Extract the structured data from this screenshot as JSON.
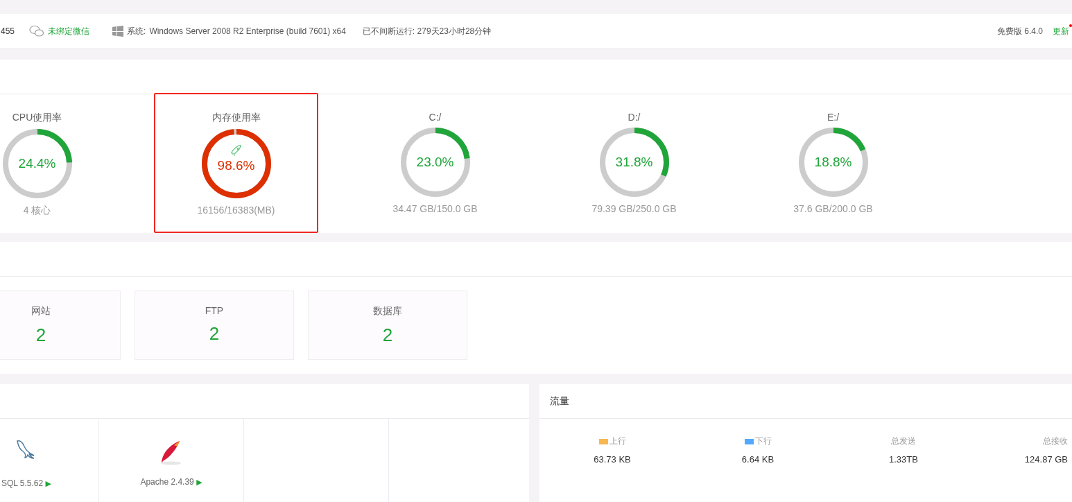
{
  "header": {
    "id_fragment": "455",
    "wechat": "未绑定微信",
    "system_label": "系统:",
    "system": "Windows Server 2008 R2 Enterprise (build 7601) x64",
    "uptime": "已不间断运行: 279天23小时28分钟",
    "version": "免费版 6.4.0",
    "update": "更新",
    "update_dot": true
  },
  "gauges": [
    {
      "title": "CPU使用率",
      "value": "24.4%",
      "level": 0.244,
      "detail": "4 核心",
      "color": "#20a53a",
      "highlighted": false,
      "rocket": false
    },
    {
      "title": "内存使用率",
      "value": "98.6%",
      "level": 0.986,
      "detail": "16156/16383(MB)",
      "color": "#dd2f00",
      "highlighted": true,
      "rocket": true
    },
    {
      "title": "C:/",
      "value": "23.0%",
      "level": 0.23,
      "detail": "34.47 GB/150.0 GB",
      "color": "#20a53a",
      "highlighted": false,
      "rocket": false
    },
    {
      "title": "D:/",
      "value": "31.8%",
      "level": 0.318,
      "detail": "79.39 GB/250.0 GB",
      "color": "#20a53a",
      "highlighted": false,
      "rocket": false
    },
    {
      "title": "E:/",
      "value": "18.8%",
      "level": 0.188,
      "detail": "37.6 GB/200.0 GB",
      "color": "#20a53a",
      "highlighted": false,
      "rocket": false
    }
  ],
  "stats": [
    {
      "label": "网站",
      "count": "2"
    },
    {
      "label": "FTP",
      "count": "2"
    },
    {
      "label": "数据库",
      "count": "2"
    }
  ],
  "software": [
    {
      "kind": "dolphin",
      "name": "SQL 5.5.62",
      "play": "▶"
    },
    {
      "kind": "feather",
      "name": "Apache 2.4.39",
      "play": "▶"
    },
    {
      "kind": "empty"
    },
    {
      "kind": "empty"
    }
  ],
  "traffic": {
    "title": "流量",
    "items": [
      {
        "label": "上行",
        "value": "63.73 KB",
        "color": "#f7b851"
      },
      {
        "label": "下行",
        "value": "6.64 KB",
        "color": "#52a9ff"
      },
      {
        "label": "总发送",
        "value": "1.33TB"
      },
      {
        "label": "总接收",
        "value": "124.87 GB"
      }
    ]
  }
}
